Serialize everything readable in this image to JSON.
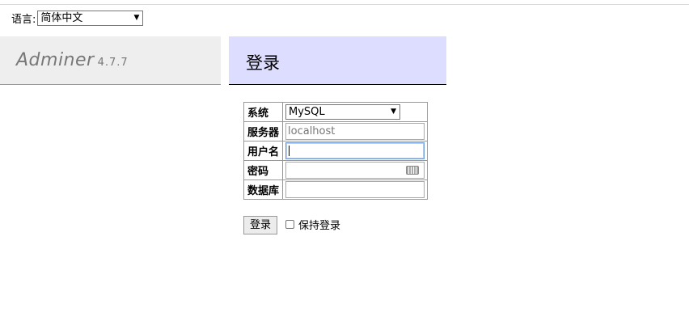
{
  "language": {
    "label": "语言:",
    "selected": "简体中文"
  },
  "brand": {
    "name": "Adminer",
    "version": "4.7.7"
  },
  "page_title": "登录",
  "form": {
    "system_label": "系统",
    "system_value": "MySQL",
    "server_label": "服务器",
    "server_placeholder": "localhost",
    "username_label": "用户名",
    "username_value": "",
    "password_label": "密码",
    "database_label": "数据库",
    "database_value": "",
    "submit_label": "登录",
    "remember_label": "保持登录"
  }
}
